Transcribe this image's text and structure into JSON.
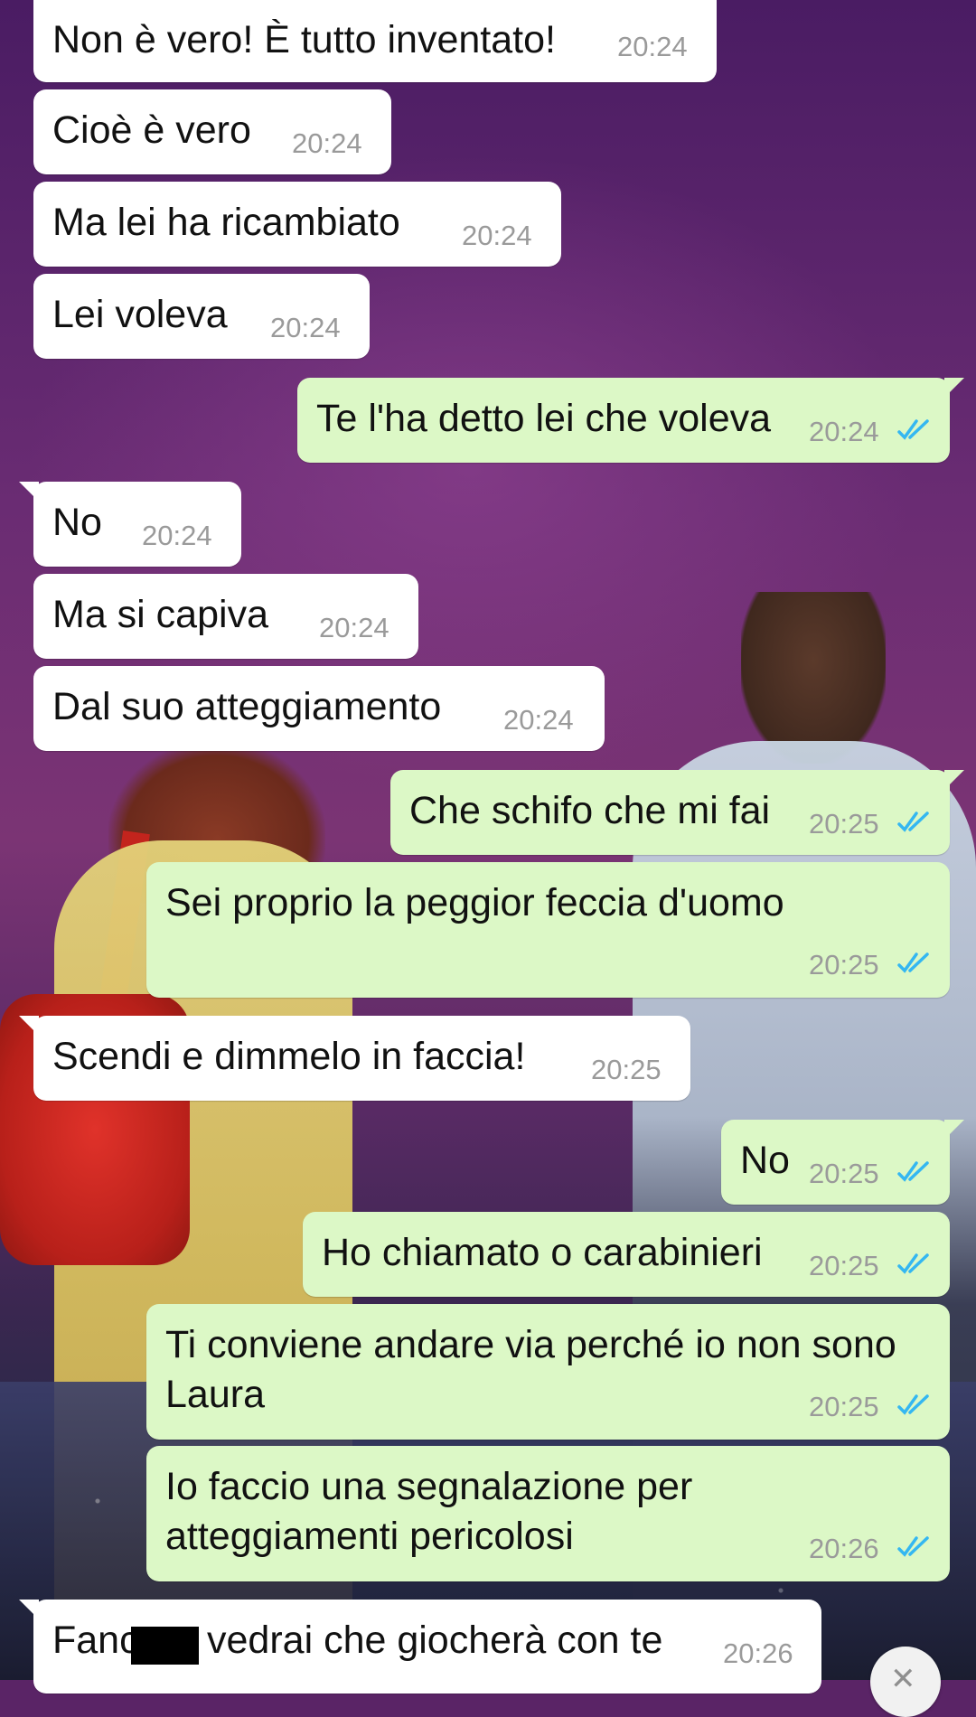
{
  "messages": [
    {
      "dir": "in",
      "text": "Non è vero! È tutto inventato!",
      "time": "20:24"
    },
    {
      "dir": "in",
      "text": "Cioè è vero",
      "time": "20:24"
    },
    {
      "dir": "in",
      "text": "Ma lei ha ricambiato",
      "time": "20:24"
    },
    {
      "dir": "in",
      "text": "Lei voleva",
      "time": "20:24"
    },
    {
      "dir": "out",
      "text": "Te l'ha detto lei che voleva",
      "time": "20:24",
      "status": "read"
    },
    {
      "dir": "in",
      "text": "No",
      "time": "20:24"
    },
    {
      "dir": "in",
      "text": "Ma si capiva",
      "time": "20:24"
    },
    {
      "dir": "in",
      "text": "Dal suo atteggiamento",
      "time": "20:24"
    },
    {
      "dir": "out",
      "text": "Che schifo che mi fai",
      "time": "20:25",
      "status": "read"
    },
    {
      "dir": "out",
      "text": "Sei proprio la peggior feccia d'uomo",
      "time": "20:25",
      "status": "read"
    },
    {
      "dir": "in",
      "text": "Scendi e dimmelo in faccia!",
      "time": "20:25"
    },
    {
      "dir": "out",
      "text": "No",
      "time": "20:25",
      "status": "read"
    },
    {
      "dir": "out",
      "text": "Ho chiamato o carabinieri",
      "time": "20:25",
      "status": "read"
    },
    {
      "dir": "out",
      "text_line1": "Ti conviene andare via perché io non sono",
      "text_line2": "Laura",
      "time": "20:25",
      "status": "read"
    },
    {
      "dir": "out",
      "text_line1": "Io faccio una segnalazione per",
      "text_line2": "atteggiamenti pericolosi",
      "time": "20:26",
      "status": "read"
    },
    {
      "dir": "in",
      "text_before": "Fanc",
      "text_after": "vedrai che giocherà con te",
      "time": "20:26"
    }
  ],
  "colors": {
    "incoming_bubble": "#ffffff",
    "outgoing_bubble": "#dcf8c6",
    "read_check": "#34b7f1",
    "timestamp": "#9a9a9a"
  },
  "icons": {
    "read": "double-check-icon",
    "scroll": "chevron-down-icon"
  }
}
